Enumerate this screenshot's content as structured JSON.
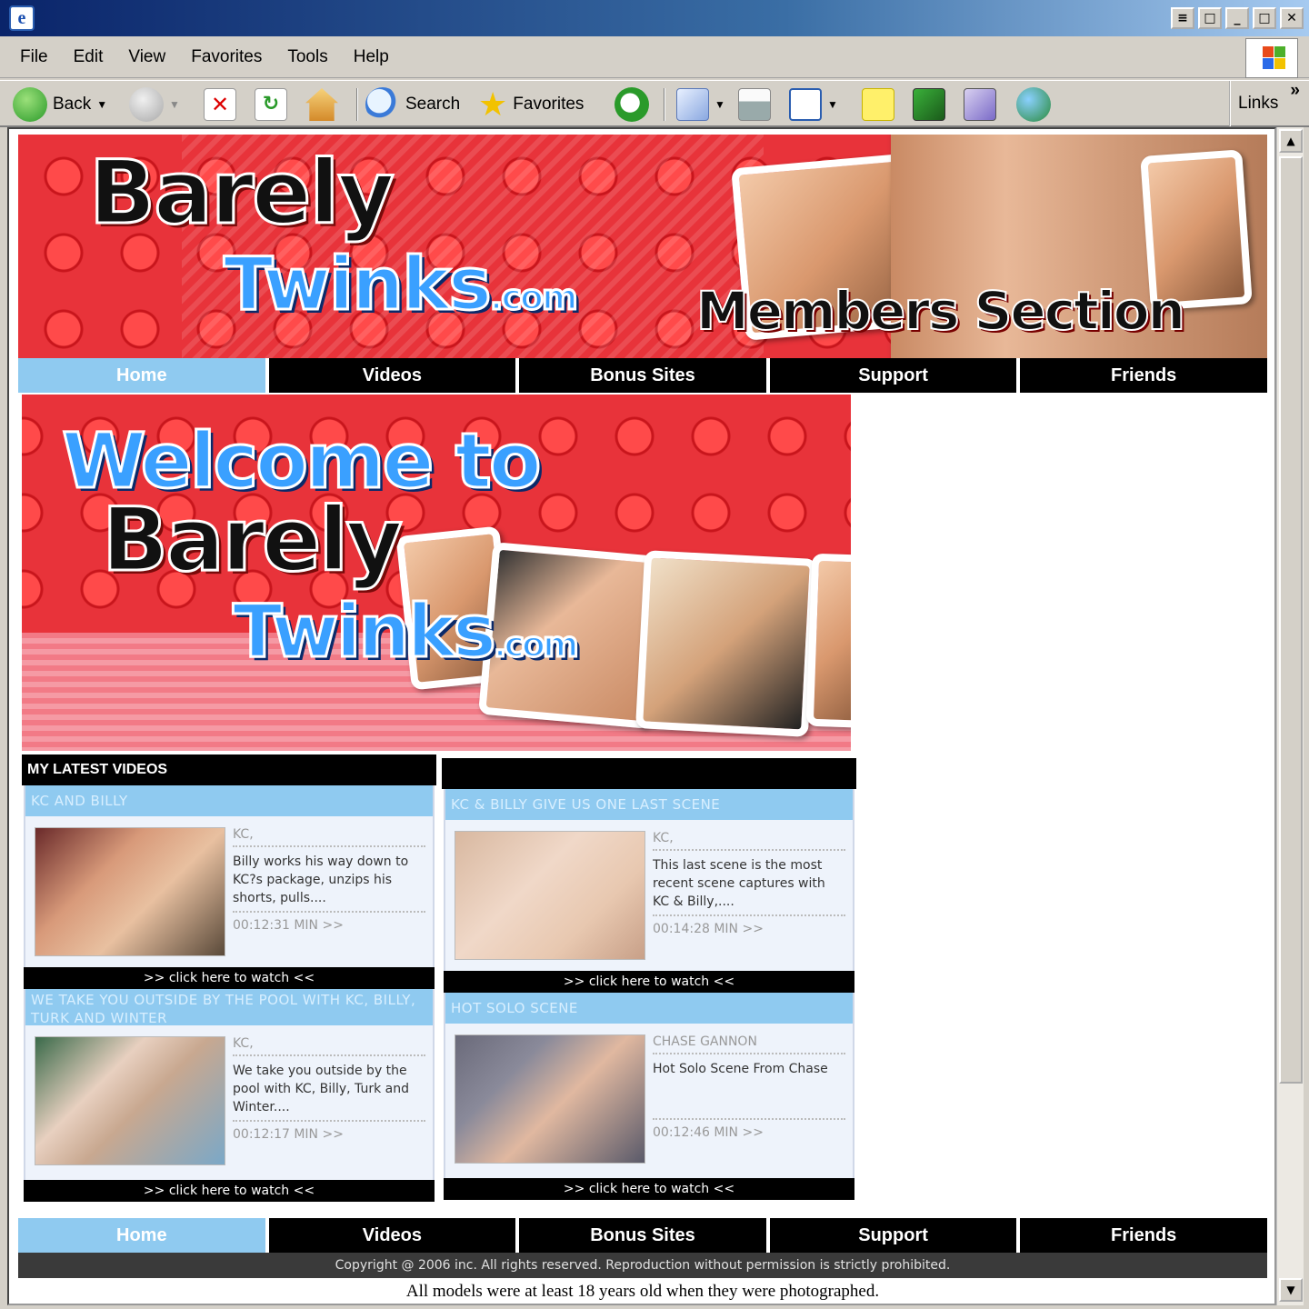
{
  "window": {
    "title_buttons": [
      "≡",
      "□",
      "_",
      "□",
      "✕"
    ]
  },
  "menubar": {
    "items": [
      "File",
      "Edit",
      "View",
      "Favorites",
      "Tools",
      "Help"
    ]
  },
  "toolbar": {
    "back_label": "Back",
    "search_label": "Search",
    "favorites_label": "Favorites",
    "links_label": "Links",
    "chevron": "»"
  },
  "header": {
    "logo_line1": "Barely",
    "logo_line2": "Twinks",
    "logo_suffix": ".com",
    "tagline": "Members Section"
  },
  "nav": {
    "items": [
      "Home",
      "Videos",
      "Bonus Sites",
      "Support",
      "Friends"
    ],
    "active_index": 0
  },
  "welcome": {
    "line1": "Welcome to",
    "line2": "Barely",
    "line3": "Twinks",
    "suffix": ".com"
  },
  "videos": {
    "section_title": "MY LATEST VIDEOS",
    "watch_label": ">> click here to watch <<",
    "items": [
      {
        "title": "KC AND BILLY",
        "performer": "KC,",
        "description": "Billy works his way down to KC?s package, unzips his shorts, pulls....",
        "duration": "00:12:31 MIN >>"
      },
      {
        "title": "KC & BILLY GIVE US ONE LAST SCENE",
        "performer": "KC,",
        "description": "This last scene is the most recent scene captures with KC & Billy,....",
        "duration": "00:14:28 MIN >>"
      },
      {
        "title": "WE TAKE YOU OUTSIDE BY THE POOL WITH KC, BILLY, TURK AND WINTER",
        "performer": "KC,",
        "description": "We take you outside by the pool with KC, Billy, Turk and Winter....",
        "duration": "00:12:17 MIN >>"
      },
      {
        "title": "HOT SOLO SCENE",
        "performer": "CHASE GANNON",
        "description": "Hot Solo Scene From Chase",
        "duration": "00:12:46 MIN >>"
      }
    ]
  },
  "footer": {
    "copyright": "Copyright @ 2006 inc. All rights reserved. Reproduction without permission is strictly prohibited.",
    "age_notice": "All models were at least 18 years old when they were photographed."
  },
  "colors": {
    "brand_red": "#e8333a",
    "nav_active": "#8fcaf0",
    "nav_bg": "#000000"
  }
}
